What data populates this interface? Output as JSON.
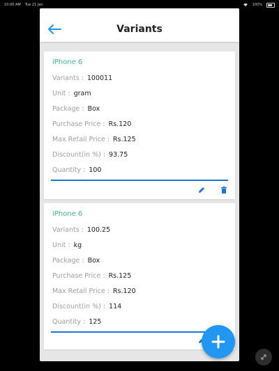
{
  "status_bar": {
    "time": "10:00 AM",
    "date": "Tue 21 Jan",
    "battery": "100%"
  },
  "appbar": {
    "title": "Variants"
  },
  "variants": [
    {
      "name": "iPhone 6",
      "fields": [
        {
          "label": "Variants :",
          "value": "100011"
        },
        {
          "label": "Unit :",
          "value": "gram"
        },
        {
          "label": "Package :",
          "value": "Box"
        },
        {
          "label": "Purchase Price :",
          "value": "Rs.120"
        },
        {
          "label": "Max Retail Price :",
          "value": "Rs.125"
        },
        {
          "label": "Discount(in %) :",
          "value": "93.75"
        },
        {
          "label": "Quantity :",
          "value": "100"
        }
      ]
    },
    {
      "name": "iPhone 6",
      "fields": [
        {
          "label": "Variants :",
          "value": "100.25"
        },
        {
          "label": "Unit :",
          "value": "kg"
        },
        {
          "label": "Package :",
          "value": "Box"
        },
        {
          "label": "Purchase Price :",
          "value": "Rs.125"
        },
        {
          "label": "Max Retail Price :",
          "value": "Rs.120"
        },
        {
          "label": "Discount(in %) :",
          "value": "114"
        },
        {
          "label": "Quantity :",
          "value": "125"
        }
      ]
    }
  ],
  "icons": {
    "back": "arrow-left-icon",
    "edit": "pencil-icon",
    "delete": "trash-icon",
    "add": "plus-icon",
    "rotate": "rotate-icon"
  },
  "colors": {
    "primary": "#2196f3",
    "accent_green": "#3fb58c",
    "background": "#e6e6e6"
  }
}
